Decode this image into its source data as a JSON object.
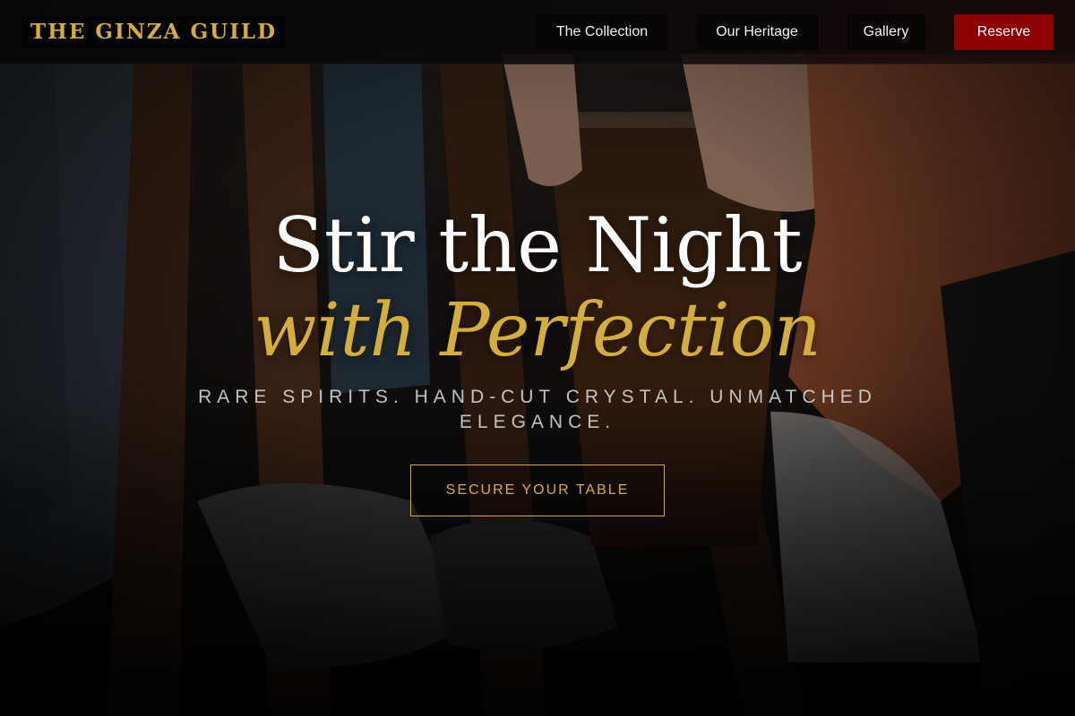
{
  "brand": {
    "name": "THE GINZA GUILD"
  },
  "nav": {
    "items": [
      {
        "label": "The Collection"
      },
      {
        "label": "Our Heritage"
      },
      {
        "label": "Gallery"
      }
    ],
    "reserve_label": "Reserve"
  },
  "hero": {
    "title_line1": "Stir the Night",
    "title_line2": "with Perfection",
    "tagline": "RARE SPIRITS. HAND-CUT CRYSTAL. UNMATCHED ELEGANCE.",
    "cta_label": "SECURE YOUR TABLE"
  },
  "colors": {
    "gold_accent": "#d4af37",
    "reserve_red": "#8b0000",
    "page_background": "#0c0a09"
  }
}
